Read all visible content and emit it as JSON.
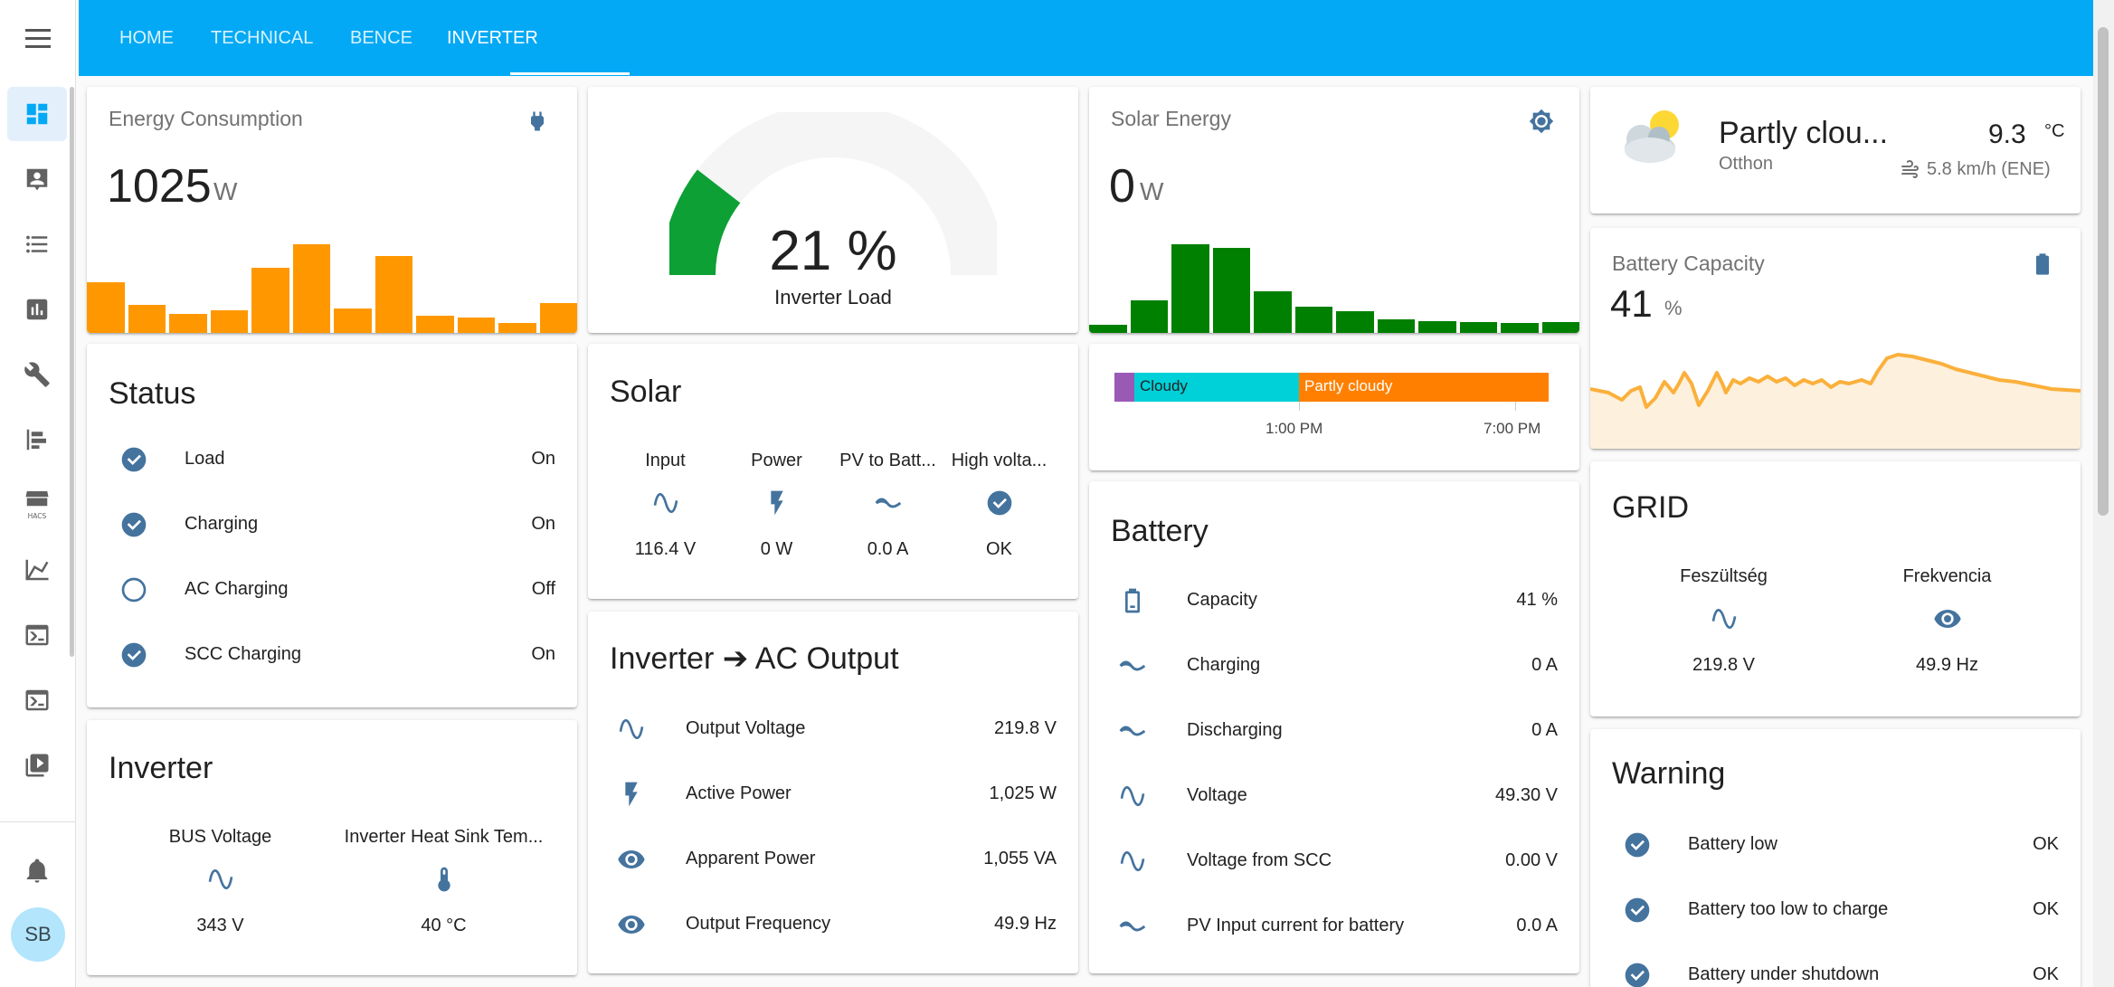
{
  "nav": {
    "tabs": [
      "HOME",
      "TECHNICAL",
      "BENCE",
      "INVERTER"
    ],
    "active_tab": "INVERTER",
    "avatar_initials": "SB",
    "sidebar_icons": [
      "overview-icon",
      "person-icon",
      "logbook-icon",
      "history-icon",
      "settings-icon",
      "map-icon",
      "hacs-icon",
      "energy-icon",
      "terminal-icon",
      "terminal2-icon",
      "media-icon",
      "notifications-icon"
    ]
  },
  "colors": {
    "accent": "#03a9f4",
    "orange": "#ff9800",
    "green": "#008000",
    "icon_blue": "#44739e",
    "gauge_green": "#0da035"
  },
  "energy_consumption": {
    "name": "Energy Consumption",
    "value": "1025",
    "unit": "W",
    "history": [
      540,
      300,
      200,
      240,
      700,
      950,
      260,
      820,
      180,
      160,
      110,
      320
    ]
  },
  "gauge": {
    "value": "21 %",
    "label": "Inverter Load",
    "percent": 21
  },
  "solar_energy": {
    "name": "Solar Energy",
    "value": "0",
    "unit": "W",
    "history": [
      100,
      400,
      1100,
      1050,
      520,
      330,
      270,
      170,
      150,
      140,
      120,
      130
    ]
  },
  "weather_timeline": {
    "segments": [
      {
        "label": ""
      },
      {
        "label": "Cloudy"
      },
      {
        "label": "Partly cloudy"
      }
    ],
    "ticks": [
      "1:00 PM",
      "7:00 PM"
    ]
  },
  "weather": {
    "condition": "Partly clou...",
    "location": "Otthon",
    "temperature": "9.3",
    "temp_unit": "°C",
    "wind": "5.8 km/h (ENE)"
  },
  "battery_capacity": {
    "name": "Battery Capacity",
    "value": "41",
    "unit": "%"
  },
  "status": {
    "title": "Status",
    "rows": [
      {
        "label": "Load",
        "value": "On",
        "on": true
      },
      {
        "label": "Charging",
        "value": "On",
        "on": true
      },
      {
        "label": "AC Charging",
        "value": "Off",
        "on": false
      },
      {
        "label": "SCC Charging",
        "value": "On",
        "on": true
      }
    ]
  },
  "solar": {
    "title": "Solar",
    "items": [
      {
        "label": "Input",
        "value": "116.4 V",
        "icon": "sine-wave-icon"
      },
      {
        "label": "Power",
        "value": "0 W",
        "icon": "flash-icon"
      },
      {
        "label": "PV to Batt...",
        "value": "0.0 A",
        "icon": "current-dc-icon"
      },
      {
        "label": "High volta...",
        "value": "OK",
        "icon": "check-circle-icon"
      }
    ]
  },
  "battery": {
    "title": "Battery",
    "rows": [
      {
        "label": "Capacity",
        "value": "41 %",
        "icon": "battery-icon"
      },
      {
        "label": "Charging",
        "value": "0 A",
        "icon": "current-dc-icon"
      },
      {
        "label": "Discharging",
        "value": "0 A",
        "icon": "current-dc-icon"
      },
      {
        "label": "Voltage",
        "value": "49.30 V",
        "icon": "sine-wave-icon"
      },
      {
        "label": "Voltage from SCC",
        "value": "0.00 V",
        "icon": "sine-wave-icon"
      },
      {
        "label": "PV Input current for battery",
        "value": "0.0 A",
        "icon": "current-dc-icon"
      }
    ]
  },
  "grid": {
    "title": "GRID",
    "items": [
      {
        "label": "Feszültség",
        "value": "219.8 V",
        "icon": "sine-wave-icon"
      },
      {
        "label": "Frekvencia",
        "value": "49.9 Hz",
        "icon": "eye-icon"
      }
    ]
  },
  "inverter": {
    "title": "Inverter",
    "items": [
      {
        "label": "BUS Voltage",
        "value": "343 V",
        "icon": "sine-wave-icon"
      },
      {
        "label": "Inverter Heat Sink Tem...",
        "value": "40 °C",
        "icon": "thermometer-icon"
      }
    ]
  },
  "ac_output": {
    "title": "Inverter ➔ AC Output",
    "rows": [
      {
        "label": "Output Voltage",
        "value": "219.8 V",
        "icon": "sine-wave-icon"
      },
      {
        "label": "Active Power",
        "value": "1,025 W",
        "icon": "flash-icon"
      },
      {
        "label": "Apparent Power",
        "value": "1,055 VA",
        "icon": "eye-icon"
      },
      {
        "label": "Output Frequency",
        "value": "49.9 Hz",
        "icon": "eye-icon"
      }
    ]
  },
  "warning": {
    "title": "Warning",
    "rows": [
      {
        "label": "Battery low",
        "value": "OK"
      },
      {
        "label": "Battery too low to charge",
        "value": "OK"
      },
      {
        "label": "Battery under shutdown",
        "value": "OK"
      }
    ]
  }
}
